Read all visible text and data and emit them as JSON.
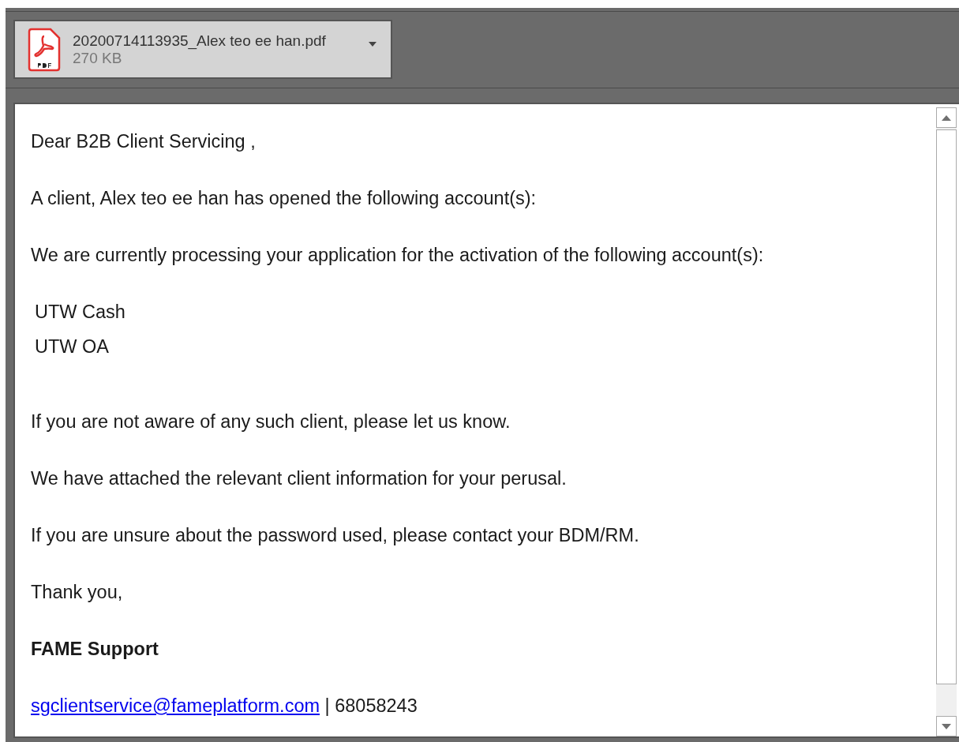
{
  "attachment": {
    "name": "20200714113935_Alex teo ee han.pdf",
    "size": "270 KB"
  },
  "message": [
    {
      "kind": "paragraph",
      "text": "Dear B2B Client Servicing ,"
    },
    {
      "kind": "paragraph",
      "text": "A client, Alex teo ee han has opened the following account(s):"
    },
    {
      "kind": "paragraph",
      "text": "We are currently processing your application for the activation of the following account(s):"
    },
    {
      "kind": "account",
      "text": "UTW Cash"
    },
    {
      "kind": "account",
      "text": "UTW OA"
    },
    {
      "kind": "paragraph",
      "text": "If you are not aware of any such client, please let us know."
    },
    {
      "kind": "paragraph",
      "text": "We have attached the relevant client information for your perusal."
    },
    {
      "kind": "paragraph",
      "text": "If you are unsure about the password used, please contact your BDM/RM."
    },
    {
      "kind": "paragraph",
      "text": "Thank you,"
    },
    {
      "kind": "signature",
      "text": "FAME Support"
    },
    {
      "kind": "contact",
      "email": "sgclientservice@fameplatform.com",
      "text": "| 68058243"
    }
  ]
}
